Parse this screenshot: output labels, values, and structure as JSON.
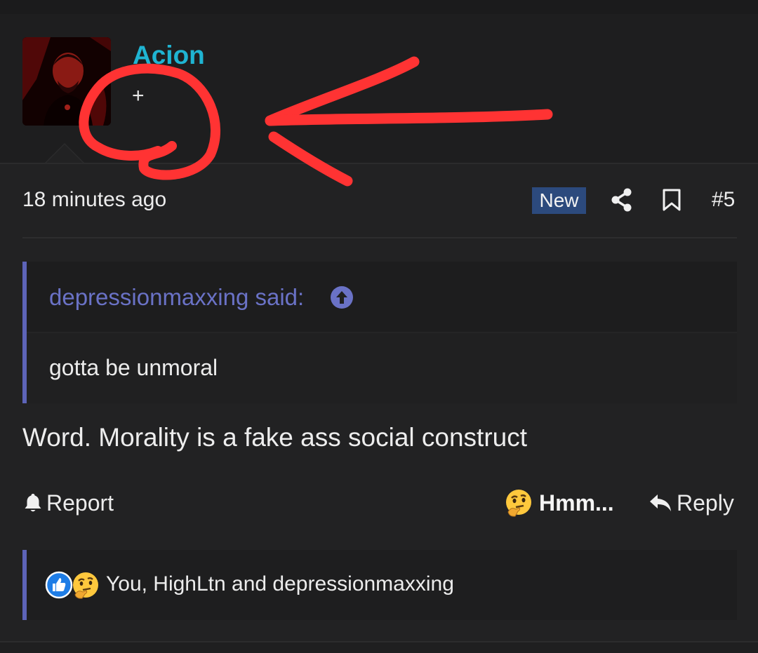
{
  "post": {
    "author": {
      "username": "Acion",
      "title": "+",
      "avatar_icon": "avatar-photo"
    },
    "meta": {
      "timestamp": "18 minutes ago",
      "new_badge": "New",
      "post_number": "#5",
      "share_icon": "share-icon",
      "bookmark_icon": "bookmark-icon"
    },
    "quote": {
      "author_label": "depressionmaxxing said:",
      "text": "gotta be unmoral",
      "jump_icon": "arrow-up-circle-icon"
    },
    "message": "Word. Morality is a fake ass social construct",
    "actions": {
      "report_label": "Report",
      "reaction_label": "Hmm...",
      "reply_label": "Reply"
    },
    "reactions": {
      "users": "You, HighLtn and depressionmaxxing",
      "icons": [
        "like-icon",
        "thinking-emoji-icon"
      ]
    }
  },
  "colors": {
    "background": "#222223",
    "username": "#1fb4d2",
    "quote_accent": "#5d64b8",
    "new_badge": "#2c4a7d",
    "annotation": "#ff3333"
  }
}
